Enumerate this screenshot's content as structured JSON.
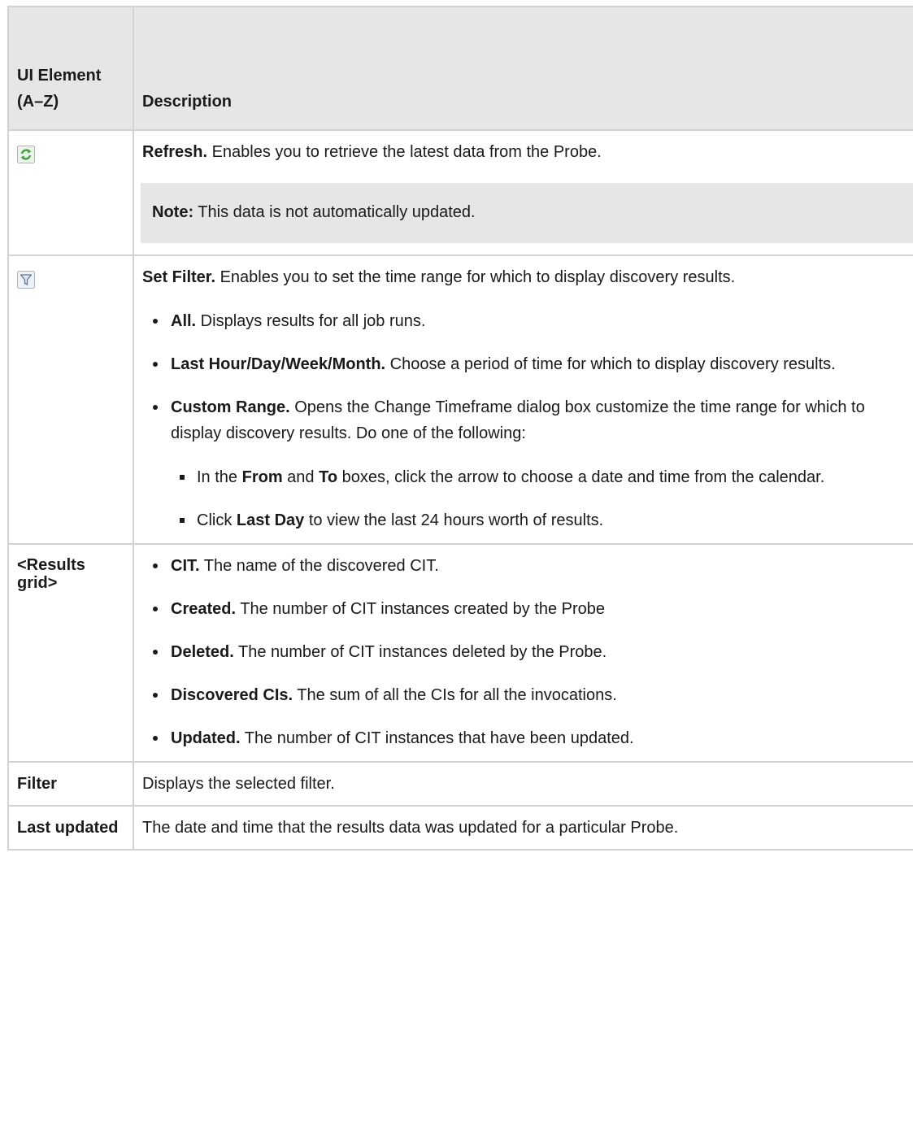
{
  "table": {
    "headers": {
      "element": "UI Element (A–Z)",
      "description": "Description"
    },
    "rows": {
      "refresh": {
        "icon": "refresh-icon",
        "title": "Refresh.",
        "text": " Enables you to retrieve the latest data from the Probe.",
        "note_label": "Note:",
        "note_text": " This data is not automatically updated."
      },
      "set_filter": {
        "icon": "filter-icon",
        "title": "Set Filter.",
        "text": " Enables you to set the time range for which to display discovery results.",
        "items": [
          {
            "label": "All.",
            "text": " Displays results for all job runs."
          },
          {
            "label": "Last Hour/Day/Week/Month.",
            "text": " Choose a period of time for which to display discovery results."
          },
          {
            "label": "Custom Range.",
            "text": " Opens the Change Timeframe dialog box customize the time range for which to display discovery results. Do one of the following:"
          }
        ],
        "subitems": {
          "first": {
            "t1": "In the ",
            "b1": "From",
            "t2": " and ",
            "b2": "To",
            "t3": " boxes, click the arrow to choose a date and time from the calendar."
          },
          "second": {
            "t1": "Click ",
            "b1": "Last Day",
            "t2": " to view the last 24 hours worth of results."
          }
        }
      },
      "results_grid": {
        "element": "<Results grid>",
        "items": [
          {
            "label": "CIT.",
            "text": " The name of the discovered CIT."
          },
          {
            "label": "Created.",
            "text": " The number of CIT instances created by the Probe"
          },
          {
            "label": "Deleted.",
            "text": " The number of CIT instances deleted by the Probe."
          },
          {
            "label": "Discovered CIs.",
            "text": " The sum of all the CIs for all the invocations."
          },
          {
            "label": "Updated.",
            "text": " The number of CIT instances that have been updated."
          }
        ]
      },
      "filter": {
        "element": "Filter",
        "text": "Displays the selected filter."
      },
      "last_updated": {
        "element": "Last updated",
        "text": "The date and time that the results data was updated for a particular Probe."
      }
    }
  },
  "colors": {
    "header_bg": "#e6e6e6",
    "border": "#d2d2d2",
    "note_bg": "#e6e6e6",
    "refresh_icon": "#3aa43a",
    "filter_icon": "#7a9ab8"
  }
}
